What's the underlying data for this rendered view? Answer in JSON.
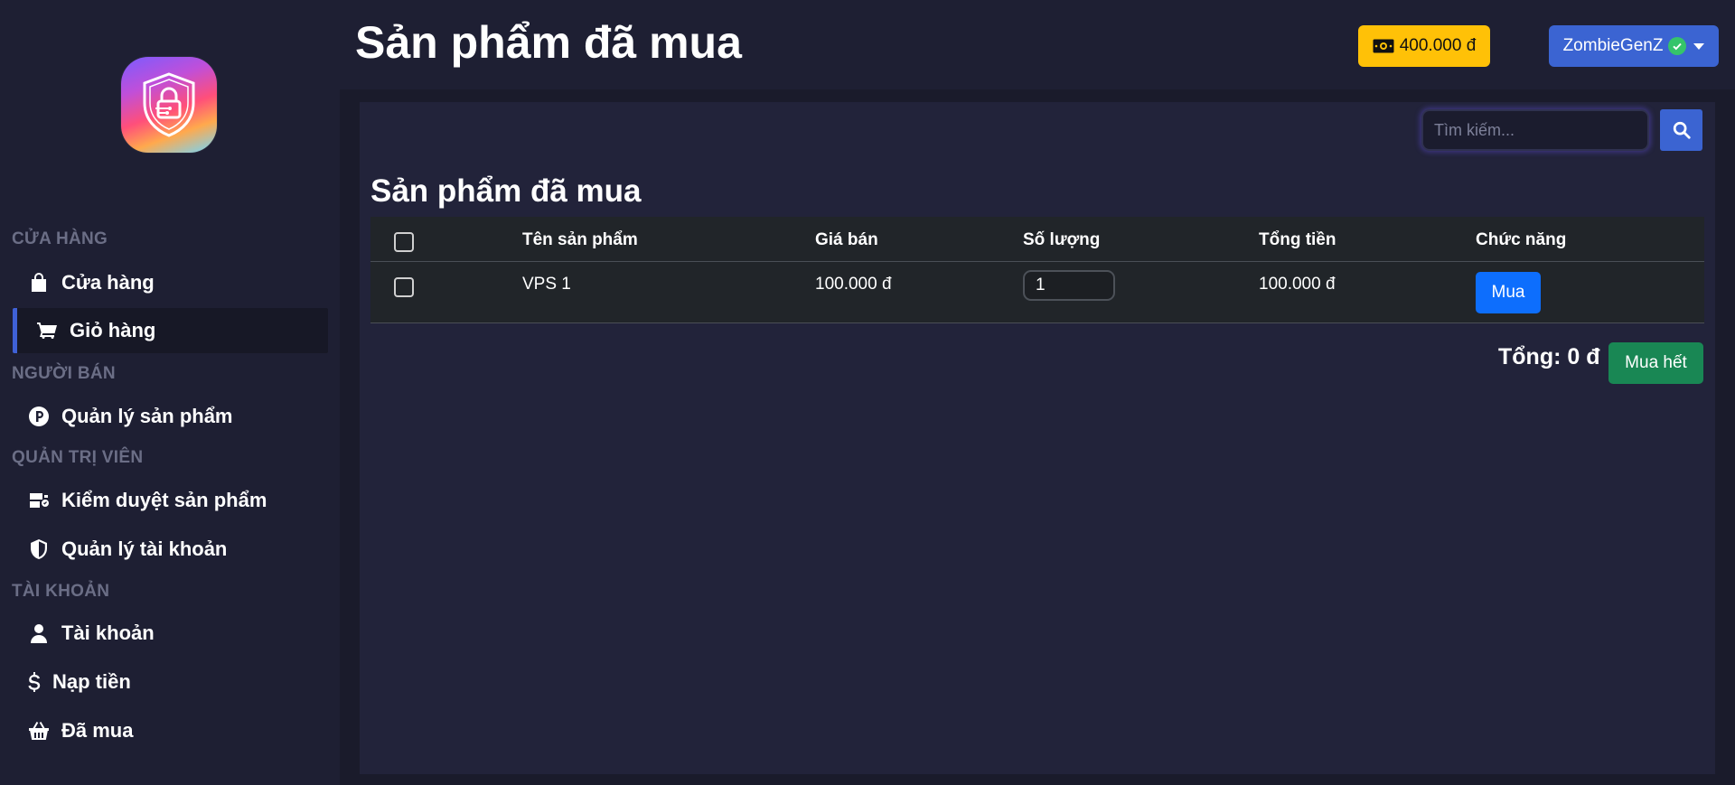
{
  "sidebar": {
    "sections": [
      {
        "label": "CỬA HÀNG",
        "items": [
          {
            "label": "Cửa hàng",
            "icon": "bag-icon",
            "active": false
          },
          {
            "label": "Giỏ hàng",
            "icon": "cart-icon",
            "active": true
          }
        ]
      },
      {
        "label": "NGƯỜI BÁN",
        "items": [
          {
            "label": "Quản lý sản phẩm",
            "icon": "product-circle-icon",
            "active": false
          }
        ]
      },
      {
        "label": "QUẢN TRỊ VIÊN",
        "items": [
          {
            "label": "Kiểm duyệt sản phẩm",
            "icon": "moderation-icon",
            "active": false
          },
          {
            "label": "Quản lý tài khoản",
            "icon": "shield-icon",
            "active": false
          }
        ]
      },
      {
        "label": "TÀI KHOẢN",
        "items": [
          {
            "label": "Tài khoản",
            "icon": "user-icon",
            "active": false
          },
          {
            "label": "Nạp tiền",
            "icon": "dollar-icon",
            "active": false
          },
          {
            "label": "Đã mua",
            "icon": "basket-icon",
            "active": false
          }
        ]
      }
    ]
  },
  "header": {
    "title": "Sản phẩm đã mua",
    "balance": "400.000 đ",
    "username": "ZombieGenZ"
  },
  "search": {
    "placeholder": "Tìm kiếm..."
  },
  "main": {
    "section_title": "Sản phẩm đã mua",
    "table": {
      "columns": [
        "Tên sản phẩm",
        "Giá bán",
        "Số lượng",
        "Tổng tiền",
        "Chức năng"
      ],
      "rows": [
        {
          "name": "VPS 1",
          "price": "100.000 đ",
          "quantity": "1",
          "total": "100.000 đ",
          "action": "Mua"
        }
      ]
    },
    "total_label": "Tổng: 0 đ",
    "buy_all_label": "Mua hết"
  },
  "colors": {
    "background": "#1e1f33",
    "card": "#22233a",
    "accent": "#3b64d2",
    "balance": "#ffc107",
    "buy": "#0d6efd",
    "buy_all": "#198754"
  }
}
